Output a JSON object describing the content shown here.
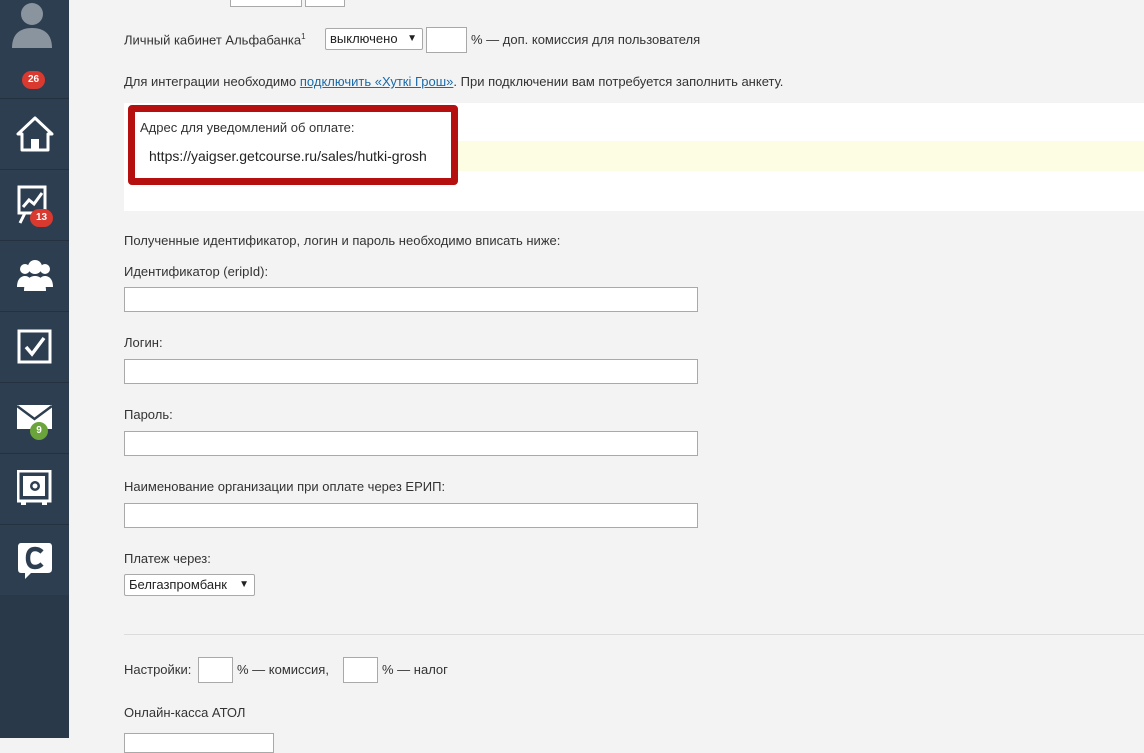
{
  "sidebar": {
    "items": [
      {
        "name": "profile",
        "badge": "26"
      },
      {
        "name": "home"
      },
      {
        "name": "stats",
        "badge": "13"
      },
      {
        "name": "users"
      },
      {
        "name": "tasks"
      },
      {
        "name": "messages",
        "badge": "9"
      },
      {
        "name": "safe"
      },
      {
        "name": "chat"
      }
    ],
    "colors": {
      "background": "#2d3e50",
      "badge_red": "#d9392f",
      "badge_green": "#6aa43a"
    }
  },
  "alfabank": {
    "label": "Личный кабинет Альфабанка",
    "sup": "1",
    "select_value": "выключено",
    "suffix": "% — доп. комиссия для пользователя"
  },
  "integration": {
    "before": "Для интеграции необходимо ",
    "link": "подключить «Хуткі Грош»",
    "after": ". При подключении вам потребуется заполнить анкету."
  },
  "notify": {
    "label": "Адрес для уведомлений об оплате:",
    "url": "https://yaigser.getcourse.ru/sales/hutki-grosh"
  },
  "instruction": "Полученные идентификатор, логин и пароль необходимо вписать ниже:",
  "fields": {
    "erip_id_label": "Идентификатор (eripId):",
    "login_label": "Логин:",
    "password_label": "Пароль:",
    "org_name_label": "Наименование организации при оплате через ЕРИП:"
  },
  "payment": {
    "label": "Платеж через:",
    "select_value": "Белгазпромбанк"
  },
  "settings": {
    "label": "Настройки:",
    "commission_suffix": "% — комиссия,",
    "tax_suffix": "% — налог"
  },
  "atol_label": "Онлайн-касса АТОЛ"
}
